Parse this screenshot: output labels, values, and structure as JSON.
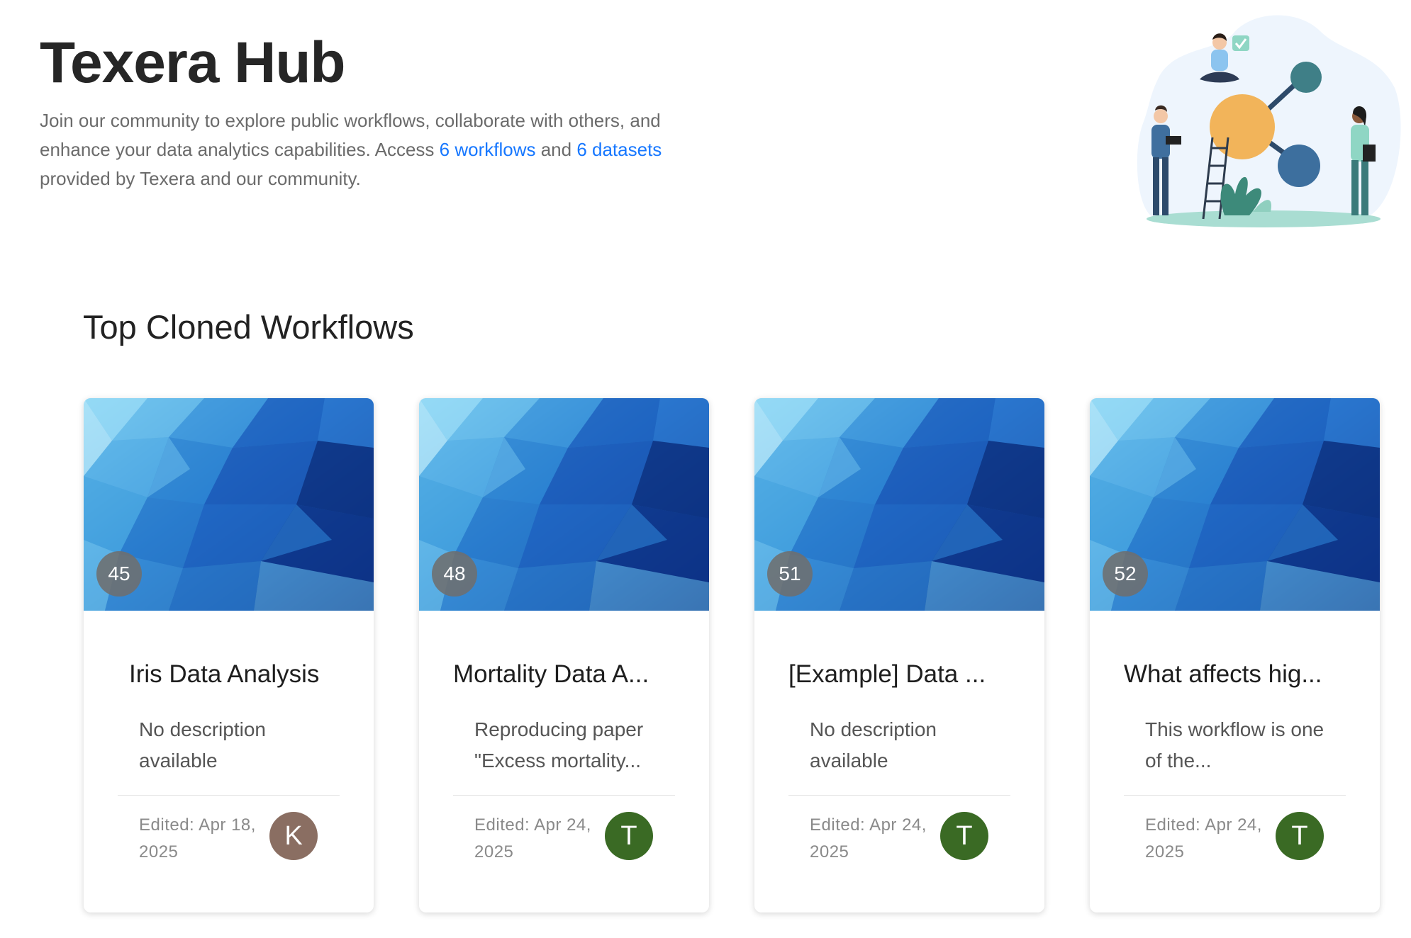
{
  "hub": {
    "title": "Texera Hub",
    "intro_before": "Join our community to explore public workflows, collaborate with others, and enhance your data analytics capabilities. Access ",
    "workflows_link": "6 workflows",
    "intro_middle": " and ",
    "datasets_link": "6 datasets",
    "intro_after": " provided by Texera and our community."
  },
  "section": {
    "title": "Top Cloned Workflows"
  },
  "cards": [
    {
      "clone_count": "45",
      "title": "Iris Data Analysis",
      "description": "No description available",
      "edited": "Edited: Apr 18, 2025",
      "avatar_letter": "K",
      "avatar_color": "#8a6e62"
    },
    {
      "clone_count": "48",
      "title": "Mortality Data A...",
      "description": "Reproducing paper \"Excess mortality...",
      "edited": "Edited: Apr 24, 2025",
      "avatar_letter": "T",
      "avatar_color": "#3a6a24"
    },
    {
      "clone_count": "51",
      "title": "[Example] Data ...",
      "description": "No description available",
      "edited": "Edited: Apr 24, 2025",
      "avatar_letter": "T",
      "avatar_color": "#3a6a24"
    },
    {
      "clone_count": "52",
      "title": "What affects hig...",
      "description": "This workflow is one of the...",
      "edited": "Edited: Apr 24, 2025",
      "avatar_letter": "T",
      "avatar_color": "#3a6a24"
    }
  ],
  "colors": {
    "link": "#1677ff",
    "cover_dark": "#0b2f7a",
    "cover_light": "#7fd0f2"
  },
  "icons": {
    "illustration": "team-collaboration-illustration"
  }
}
